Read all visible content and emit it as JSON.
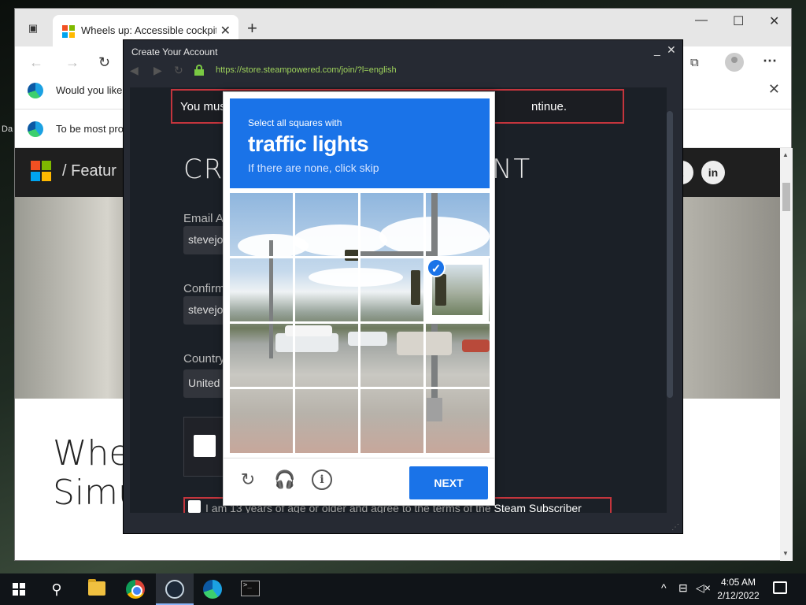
{
  "desktop": {
    "edge_text": "Da"
  },
  "browser": {
    "tab_title": "Wheels up: Accessible cockpit fo",
    "new_tab_label": "+",
    "minimize": "—",
    "maximize": "☐",
    "close": "✕",
    "infobars": [
      {
        "text": "Would you like"
      },
      {
        "text": "To be most pro"
      }
    ],
    "site": {
      "crumb": "/  Featur",
      "social": [
        "t",
        "in"
      ],
      "article_title_line1": "Whe",
      "article_title_line2": "Simu"
    }
  },
  "steam": {
    "window_title": "Create Your Account",
    "url": "https://store.steampowered.com/join/?l=english",
    "error_left": "You mus",
    "error_right": "ntinue.",
    "heading_left": "CRI",
    "heading_right": "NT",
    "email_label": "Email Ac",
    "email_value": "stevejo",
    "confirm_label": "Confirm",
    "confirm_value": "stevejo",
    "country_label": "Country",
    "country_value": "United",
    "agree_text": "I am 13 years of age or older and agree to the terms of the ",
    "agree_link": "Steam Subscriber"
  },
  "captcha": {
    "instruction_small": "Select all squares with",
    "instruction_target": "traffic lights",
    "instruction_sub": "If there are none, click skip",
    "next_label": "NEXT",
    "selected_tiles": [
      7
    ]
  },
  "taskbar": {
    "time": "4:05 AM",
    "date": "2/12/2022"
  }
}
